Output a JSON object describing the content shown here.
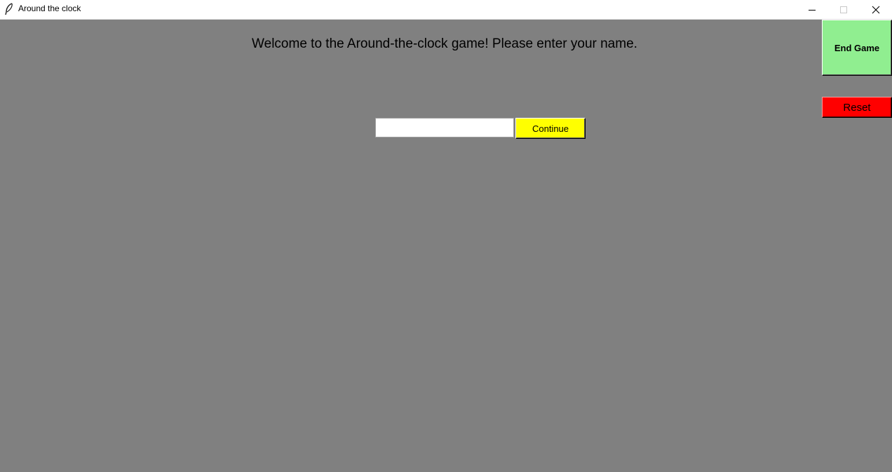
{
  "window": {
    "title": "Around the clock",
    "icon": "feather-icon",
    "controls": [
      "minimize-icon",
      "maximize-icon",
      "close-icon"
    ]
  },
  "main": {
    "welcome_text": "Welcome to the Around-the-clock game! Please enter your name.",
    "name_input": {
      "value": "",
      "placeholder": ""
    },
    "continue_label": "Continue"
  },
  "side": {
    "end_game_label": "End Game",
    "reset_label": "Reset"
  },
  "colors": {
    "background": "#808080",
    "continue_button": "#ffff00",
    "end_game_button": "#90ee90",
    "reset_button": "#ff0000"
  }
}
